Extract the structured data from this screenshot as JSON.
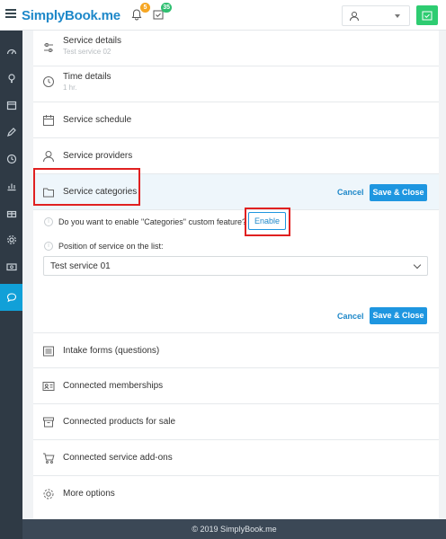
{
  "header": {
    "brand": "SimplyBook.me",
    "notifications_count": "5",
    "tasks_count": "35"
  },
  "service_sections": {
    "details": {
      "title": "Service details",
      "subtitle": "Test service 02"
    },
    "time": {
      "title": "Time details",
      "subtitle": "1 hr."
    },
    "schedule": "Service schedule",
    "providers": "Service providers",
    "categories": "Service categories"
  },
  "categories_panel": {
    "cancel_label": "Cancel",
    "save_label": "Save & Close",
    "enable_question": "Do you want to enable \"Categories\" custom feature?",
    "enable_label": "Enable",
    "position_label": "Position of service on the list:",
    "position_value": "Test service 01"
  },
  "other_sections": {
    "intake": "Intake forms (questions)",
    "memberships": "Connected memberships",
    "products": "Connected products for sale",
    "addons": "Connected service add-ons",
    "more": "More options"
  },
  "footer": {
    "copyright": "© 2019 SimplyBook.me"
  },
  "colors": {
    "accent": "#1e96e0",
    "sidebar": "#2f3a45",
    "highlight": "#e02020"
  }
}
